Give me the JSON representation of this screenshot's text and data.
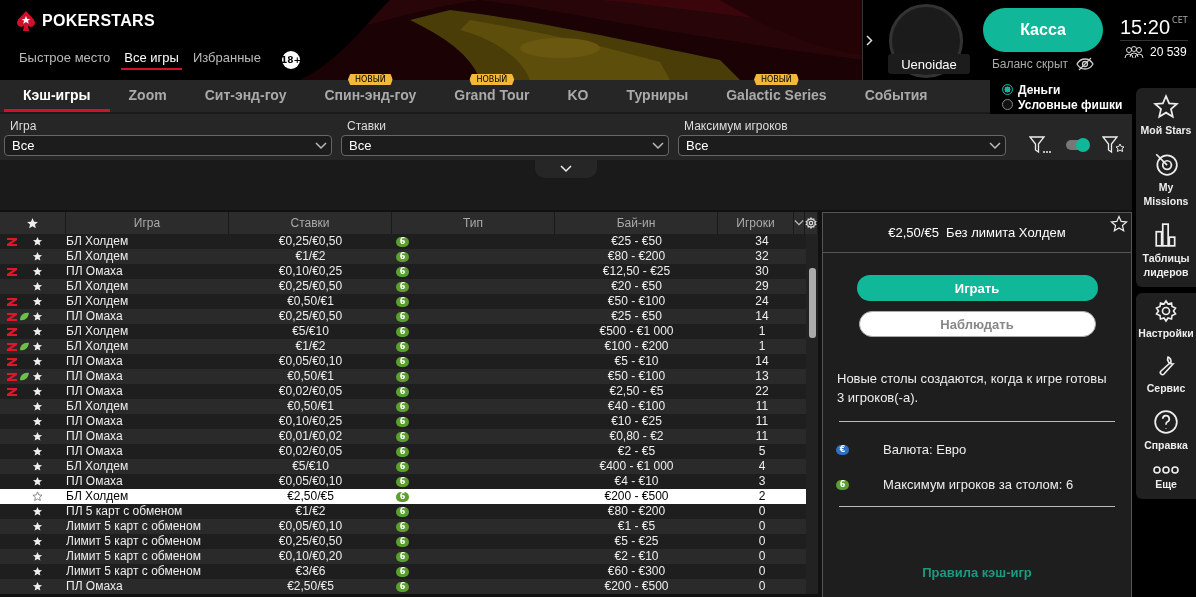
{
  "brand": {
    "name": "POKERSTARS"
  },
  "top_nav": [
    {
      "label": "Быстрое место",
      "selected": false
    },
    {
      "label": "Все игры",
      "selected": true
    },
    {
      "label": "Избранные",
      "selected": false
    }
  ],
  "age_badge": "18+",
  "account": {
    "username": "Uenoidae",
    "cashier_button": "Касса",
    "balance": "Баланс скрыт",
    "time": "15:20",
    "timezone": "CET",
    "players_online": "20 539"
  },
  "tabs": [
    {
      "label": "Кэш-игры",
      "selected": true
    },
    {
      "label": "Zoom",
      "selected": false
    },
    {
      "label": "Сит-энд-гоу",
      "selected": false
    },
    {
      "label": "Спин-энд-гоу",
      "selected": false,
      "badge": "НОВЫЙ"
    },
    {
      "label": "Grand Tour",
      "selected": false,
      "badge": "НОВЫЙ"
    },
    {
      "label": "KO",
      "selected": false
    },
    {
      "label": "Турниры",
      "selected": false
    },
    {
      "label": "Galactic Series",
      "selected": false,
      "badge": "НОВЫЙ"
    },
    {
      "label": "События",
      "selected": false
    }
  ],
  "currency_mode": [
    {
      "label": "Деньги",
      "selected": true
    },
    {
      "label": "Условные фишки",
      "selected": false
    }
  ],
  "filters": [
    {
      "label": "Игра",
      "value": "Все"
    },
    {
      "label": "Ставки",
      "value": "Все"
    },
    {
      "label": "Максимум игроков",
      "value": "Все"
    }
  ],
  "filter_toggle": {
    "on": true
  },
  "table": {
    "columns": [
      "Игра",
      "Ставки",
      "Тип",
      "Бай-ин",
      "Игроки"
    ],
    "rows": [
      {
        "zoom": true,
        "bird": false,
        "game": "БЛ Холдем",
        "stakes": "€0,25/€0,50",
        "type": "6",
        "buyin": "€25 - €50",
        "players": "34",
        "selected": false
      },
      {
        "zoom": false,
        "bird": false,
        "game": "БЛ Холдем",
        "stakes": "€1/€2",
        "type": "6",
        "buyin": "€80 - €200",
        "players": "32",
        "selected": false
      },
      {
        "zoom": true,
        "bird": false,
        "game": "ПЛ Омаха",
        "stakes": "€0,10/€0,25",
        "type": "6",
        "buyin": "€12,50 - €25",
        "players": "30",
        "selected": false
      },
      {
        "zoom": false,
        "bird": false,
        "game": "БЛ Холдем",
        "stakes": "€0,25/€0,50",
        "type": "6",
        "buyin": "€20 - €50",
        "players": "29",
        "selected": false
      },
      {
        "zoom": true,
        "bird": false,
        "game": "БЛ Холдем",
        "stakes": "€0,50/€1",
        "type": "6",
        "buyin": "€50 - €100",
        "players": "24",
        "selected": false
      },
      {
        "zoom": true,
        "bird": true,
        "game": "ПЛ Омаха",
        "stakes": "€0,25/€0,50",
        "type": "6",
        "buyin": "€25 - €50",
        "players": "14",
        "selected": false
      },
      {
        "zoom": true,
        "bird": false,
        "game": "БЛ Холдем",
        "stakes": "€5/€10",
        "type": "6",
        "buyin": "€500 - €1 000",
        "players": "1",
        "selected": false
      },
      {
        "zoom": true,
        "bird": true,
        "game": "БЛ Холдем",
        "stakes": "€1/€2",
        "type": "6",
        "buyin": "€100 - €200",
        "players": "1",
        "selected": false
      },
      {
        "zoom": true,
        "bird": false,
        "game": "ПЛ Омаха",
        "stakes": "€0,05/€0,10",
        "type": "6",
        "buyin": "€5 - €10",
        "players": "14",
        "selected": false
      },
      {
        "zoom": true,
        "bird": true,
        "game": "ПЛ Омаха",
        "stakes": "€0,50/€1",
        "type": "6",
        "buyin": "€50 - €100",
        "players": "13",
        "selected": false
      },
      {
        "zoom": true,
        "bird": false,
        "game": "ПЛ Омаха",
        "stakes": "€0,02/€0,05",
        "type": "6",
        "buyin": "€2,50 - €5",
        "players": "22",
        "selected": false
      },
      {
        "zoom": false,
        "bird": false,
        "game": "БЛ Холдем",
        "stakes": "€0,50/€1",
        "type": "6",
        "buyin": "€40 - €100",
        "players": "11",
        "selected": false
      },
      {
        "zoom": false,
        "bird": false,
        "game": "ПЛ Омаха",
        "stakes": "€0,10/€0,25",
        "type": "6",
        "buyin": "€10 - €25",
        "players": "11",
        "selected": false
      },
      {
        "zoom": false,
        "bird": false,
        "game": "ПЛ Омаха",
        "stakes": "€0,01/€0,02",
        "type": "6",
        "buyin": "€0,80 - €2",
        "players": "11",
        "selected": false
      },
      {
        "zoom": false,
        "bird": false,
        "game": "ПЛ Омаха",
        "stakes": "€0,02/€0,05",
        "type": "6",
        "buyin": "€2 - €5",
        "players": "5",
        "selected": false
      },
      {
        "zoom": false,
        "bird": false,
        "game": "БЛ Холдем",
        "stakes": "€5/€10",
        "type": "6",
        "buyin": "€400 - €1 000",
        "players": "4",
        "selected": false
      },
      {
        "zoom": false,
        "bird": false,
        "game": "ПЛ Омаха",
        "stakes": "€0,05/€0,10",
        "type": "6",
        "buyin": "€4 - €10",
        "players": "3",
        "selected": false
      },
      {
        "zoom": false,
        "bird": false,
        "game": "БЛ Холдем",
        "stakes": "€2,50/€5",
        "type": "6",
        "buyin": "€200 - €500",
        "players": "2",
        "selected": true
      },
      {
        "zoom": false,
        "bird": false,
        "game": "ПЛ 5 карт с обменом",
        "stakes": "€1/€2",
        "type": "6",
        "buyin": "€80 - €200",
        "players": "0",
        "selected": false
      },
      {
        "zoom": false,
        "bird": false,
        "game": "Лимит 5 карт с обменом",
        "stakes": "€0,05/€0,10",
        "type": "6",
        "buyin": "€1 - €5",
        "players": "0",
        "selected": false
      },
      {
        "zoom": false,
        "bird": false,
        "game": "Лимит 5 карт с обменом",
        "stakes": "€0,25/€0,50",
        "type": "6",
        "buyin": "€5 - €25",
        "players": "0",
        "selected": false
      },
      {
        "zoom": false,
        "bird": false,
        "game": "Лимит 5 карт с обменом",
        "stakes": "€0,10/€0,20",
        "type": "6",
        "buyin": "€2 - €10",
        "players": "0",
        "selected": false
      },
      {
        "zoom": false,
        "bird": false,
        "game": "Лимит 5 карт с обменом",
        "stakes": "€3/€6",
        "type": "6",
        "buyin": "€60 - €300",
        "players": "0",
        "selected": false
      },
      {
        "zoom": false,
        "bird": false,
        "game": "ПЛ Омаха",
        "stakes": "€2,50/€5",
        "type": "6",
        "buyin": "€200 - €500",
        "players": "0",
        "selected": false
      }
    ]
  },
  "details": {
    "title": "€2,50/€5  Без лимита Холдем",
    "play_button": "Играть",
    "watch_button": "Наблюдать",
    "note": "Новые столы создаются, когда к игре готовы 3 игроков(-а).",
    "info": [
      {
        "kind": "currency",
        "badge": "€",
        "text": "Валюта: Евро"
      },
      {
        "kind": "seats",
        "badge": "6",
        "text": "Максимум игроков за столом: 6"
      }
    ],
    "rules_link": "Правила кэш-игр"
  },
  "sidebar": {
    "groups": [
      [
        {
          "kind": "star",
          "label": "Мой Stars"
        },
        {
          "kind": "target",
          "label": "My Missions"
        },
        {
          "kind": "chart",
          "label": "Таблицы лидеров"
        }
      ],
      [
        {
          "kind": "gear",
          "label": "Настройки"
        },
        {
          "kind": "wrench",
          "label": "Сервис"
        },
        {
          "kind": "help",
          "label": "Справка"
        },
        {
          "kind": "more",
          "label": "Еще"
        }
      ]
    ]
  }
}
